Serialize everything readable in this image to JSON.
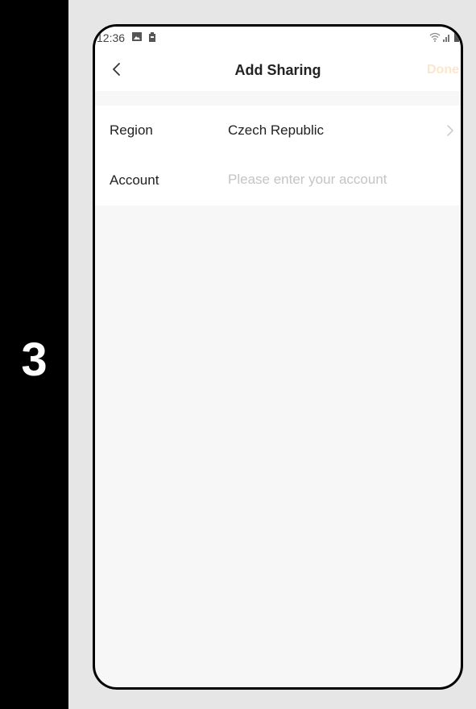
{
  "step": {
    "number": "3"
  },
  "status_bar": {
    "time": "12:36",
    "left_icons": [
      "image-icon",
      "battery-saver-icon"
    ],
    "right_icons": [
      "wifi-icon",
      "signal-icon",
      "battery-icon"
    ]
  },
  "nav": {
    "back_icon": "chevron-left-icon",
    "title": "Add Sharing",
    "done_label": "Done"
  },
  "form": {
    "region": {
      "label": "Region",
      "value": "Czech Republic"
    },
    "account": {
      "label": "Account",
      "value": "",
      "placeholder": "Please enter your account"
    }
  },
  "colors": {
    "done_disabled": "#fbe6cd",
    "page_background": "#f7f7f7",
    "side_band": "#000000"
  }
}
